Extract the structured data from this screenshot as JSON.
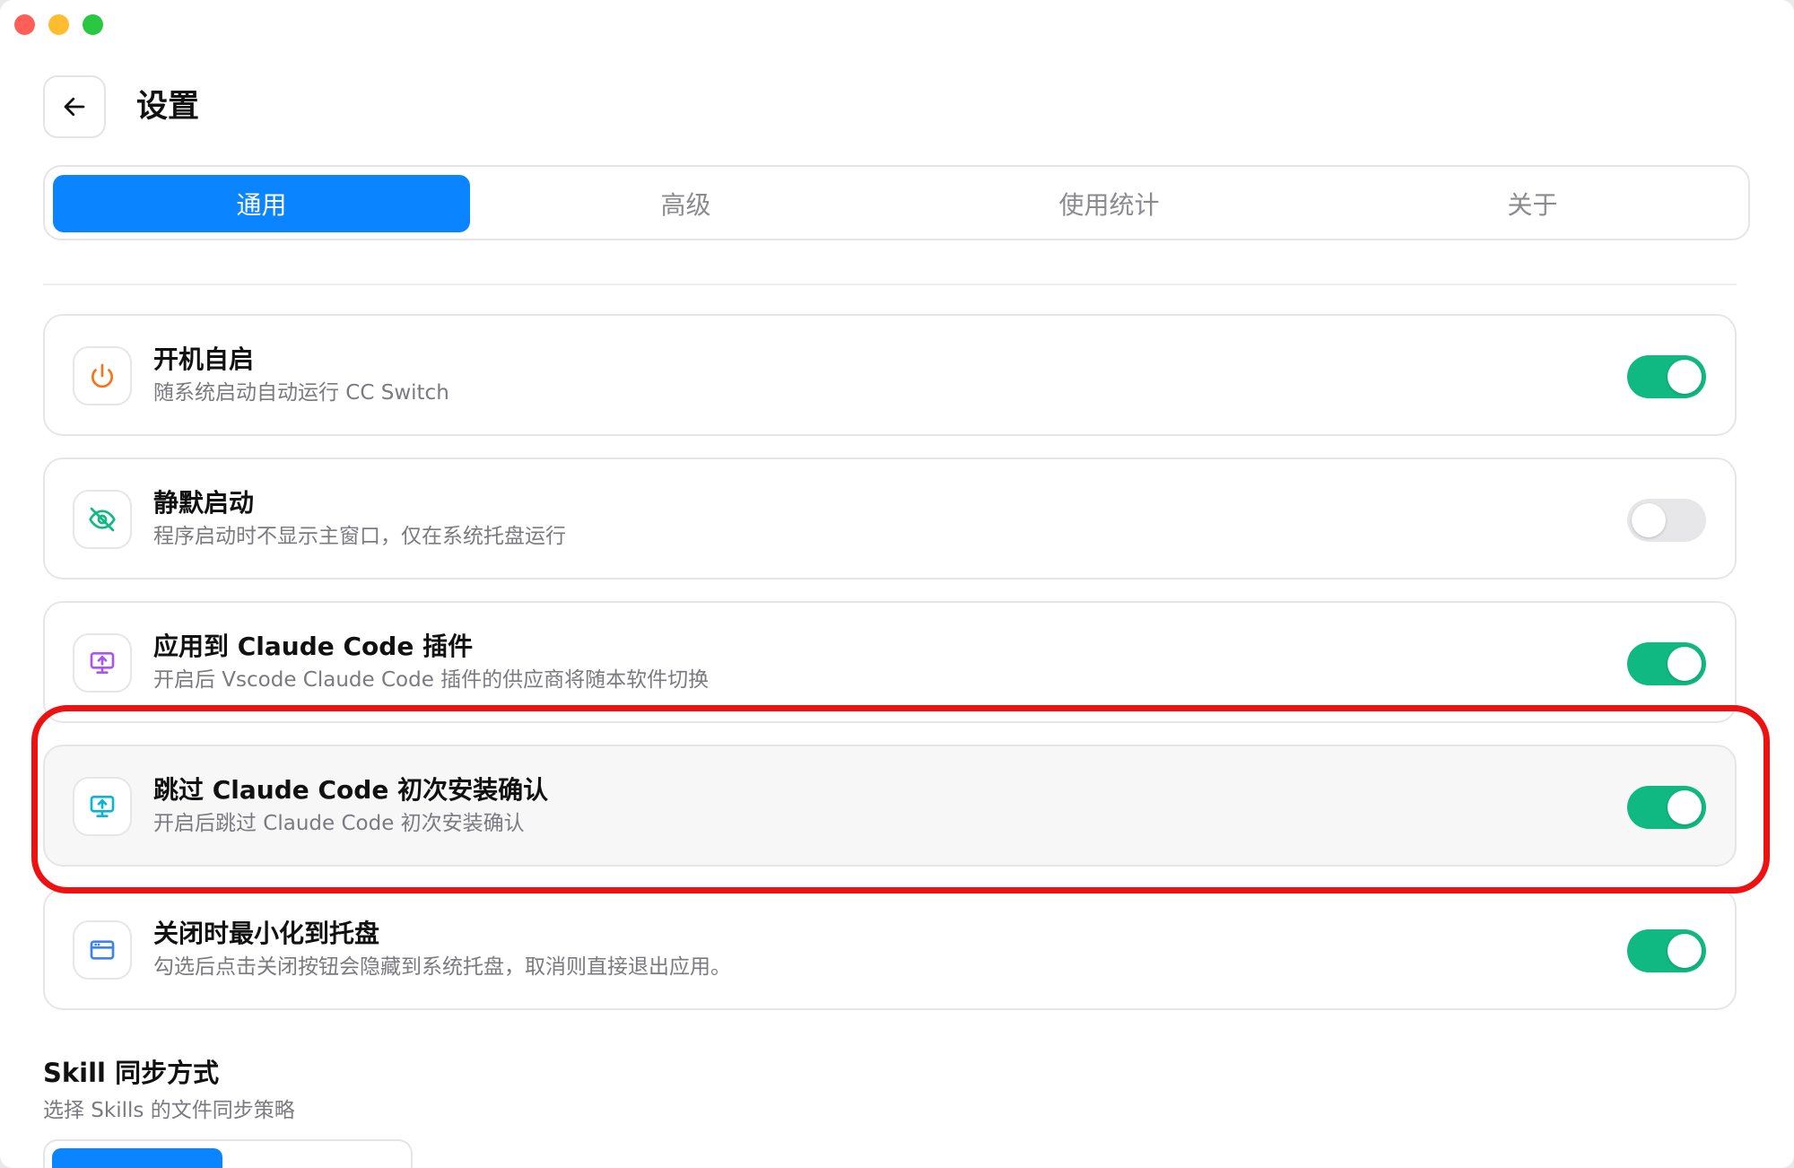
{
  "header": {
    "title": "设置"
  },
  "tabs": [
    {
      "label": "通用",
      "active": true
    },
    {
      "label": "高级",
      "active": false
    },
    {
      "label": "使用统计",
      "active": false
    },
    {
      "label": "关于",
      "active": false
    }
  ],
  "settings": [
    {
      "title": "开机自启",
      "desc": "随系统启动自动运行 CC Switch",
      "enabled": true,
      "icon": "power-icon",
      "icon_color": "#f97316"
    },
    {
      "title": "静默启动",
      "desc": "程序启动时不显示主窗口，仅在系统托盘运行",
      "enabled": false,
      "icon": "eye-off-icon",
      "icon_color": "#10b981"
    },
    {
      "title": "应用到 Claude Code 插件",
      "desc": "开启后 Vscode Claude Code 插件的供应商将随本软件切换",
      "enabled": true,
      "icon": "monitor-upload-icon",
      "icon_color": "#a855f7"
    },
    {
      "title": "跳过 Claude Code 初次安装确认",
      "desc": "开启后跳过 Claude Code 初次安装确认",
      "enabled": true,
      "icon": "monitor-upload-icon",
      "icon_color": "#06b6d4",
      "highlighted": true
    },
    {
      "title": "关闭时最小化到托盘",
      "desc": "勾选后点击关闭按钮会隐藏到系统托盘，取消则直接退出应用。",
      "enabled": true,
      "icon": "window-icon",
      "icon_color": "#3b82f6"
    }
  ],
  "skill_sync": {
    "title": "Skill 同步方式",
    "desc": "选择 Skills 的文件同步策略"
  },
  "colors": {
    "accent": "#0a84ff",
    "toggle_on": "#10b981",
    "highlight": "#ee1111"
  }
}
